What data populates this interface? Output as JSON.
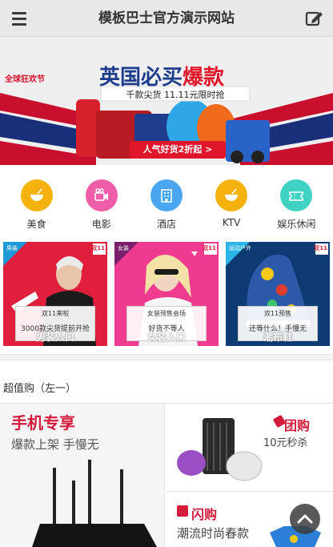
{
  "header": {
    "title": "模板巴士官方演示网站",
    "menu_icon": "menu-icon",
    "edit_icon": "edit-icon"
  },
  "banner": {
    "logo_text": "全球狂欢节",
    "headline_a": "英国必买",
    "headline_b": "爆款",
    "subline": "千款尖货 11.11元限时抢",
    "badge": "人气好货2折起 >"
  },
  "categories": [
    {
      "label": "美食",
      "icon": "bowl-icon",
      "color": "#f5b20d"
    },
    {
      "label": "电影",
      "icon": "camera-icon",
      "color": "#ee5ea8"
    },
    {
      "label": "酒店",
      "icon": "hotel-icon",
      "color": "#4aa6ef"
    },
    {
      "label": "KTV",
      "icon": "bowl-icon",
      "color": "#f5b20d"
    },
    {
      "label": "娱乐休闲",
      "icon": "ticket-icon",
      "color": "#3fd1c1"
    }
  ],
  "tiles": [
    {
      "tag": "男装",
      "sub": "双11来啦",
      "desc": "3000款尖货提前开抢",
      "name": "男装入口",
      "badge": "双11"
    },
    {
      "tag": "女装",
      "sub": "女装预售会场",
      "desc": "好货不等人",
      "name": "女装入口",
      "badge": "双11"
    },
    {
      "tag": "运动户外",
      "sub": "双11预售",
      "desc": "还等什么！手慢无",
      "name": "潮布鞋",
      "badge": "双11"
    }
  ],
  "section": {
    "title": "超值购（左一）"
  },
  "deals": {
    "left": {
      "heading": "手机专享",
      "sub": "爆款上架 手慢无"
    },
    "right_top": {
      "heading": "团购",
      "sub": "10元秒杀"
    },
    "right_bottom": {
      "heading": "闪购",
      "sub": "潮流时尚春款"
    }
  },
  "colors": {
    "accent_red": "#d41b3c",
    "header_bg": "#e8e8e8"
  },
  "back_to_top_icon": "chevron-up-icon"
}
